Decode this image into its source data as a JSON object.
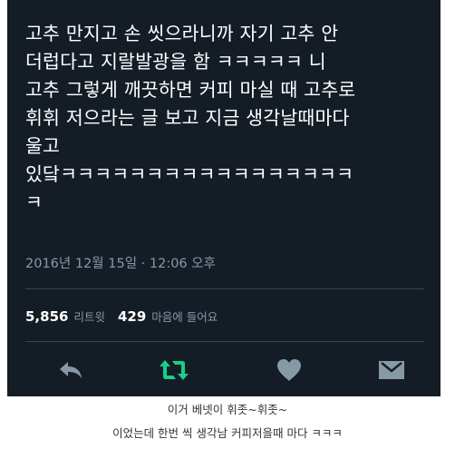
{
  "tweet": {
    "lines": [
      "고추 만지고 손 씻으라니까 자기 고추 안",
      "더럽다고 지랄발광을 함 ㅋㅋㅋㅋㅋ 니",
      "고추 그렇게 깨끗하면 커피 마실 때 고추로",
      "휘휘 저으라는 글 보고 지금 생각날때마다",
      "울고",
      "있닼ㅋㅋㅋㅋㅋㅋㅋㅋㅋㅋㅋㅋㅋㅋㅋㅋㅋ",
      "ㅋ"
    ],
    "timestamp": "2016년 12월 15일 · 12:06 오후",
    "retweets_count": "5,856",
    "retweets_label": "리트윗",
    "likes_count": "429",
    "likes_label": "마음에 들어요"
  },
  "actions": {
    "reply_icon": "reply-arrow-icon",
    "retweet_icon": "retweet-icon",
    "like_icon": "heart-icon",
    "dm_icon": "envelope-icon",
    "colors": {
      "icon": "#8899a6",
      "retweet_active": "#19cf86"
    }
  },
  "caption": {
    "line1": "이거 베넷이 휘좃~휘좃~",
    "line2": "이었는데 한번 씩 생각남 커피저을때 마다 ㅋㅋㅋ"
  },
  "colors": {
    "background": "#141d26",
    "text": "#ffffff",
    "muted": "#8899a6"
  }
}
